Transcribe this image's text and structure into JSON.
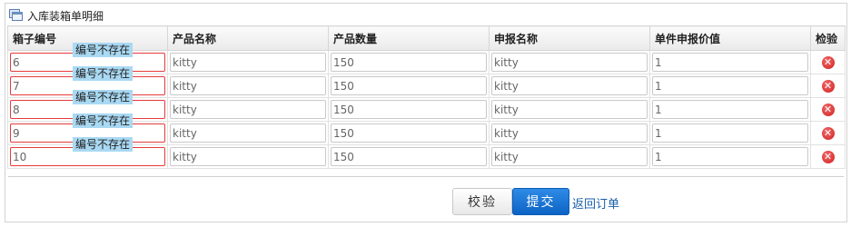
{
  "panel": {
    "title": "入库装箱单明细",
    "icon": "window-icon"
  },
  "table": {
    "headers": [
      "箱子编号",
      "产品名称",
      "产品数量",
      "申报名称",
      "单件申报价值",
      "检验"
    ],
    "error_tip": "编号不存在",
    "rows": [
      {
        "box_no": "6",
        "product_name": "kitty",
        "quantity": "150",
        "declare_name": "kitty",
        "unit_value": "1"
      },
      {
        "box_no": "7",
        "product_name": "kitty",
        "quantity": "150",
        "declare_name": "kitty",
        "unit_value": "1"
      },
      {
        "box_no": "8",
        "product_name": "kitty",
        "quantity": "150",
        "declare_name": "kitty",
        "unit_value": "1"
      },
      {
        "box_no": "9",
        "product_name": "kitty",
        "quantity": "150",
        "declare_name": "kitty",
        "unit_value": "1"
      },
      {
        "box_no": "10",
        "product_name": "kitty",
        "quantity": "150",
        "declare_name": "kitty",
        "unit_value": "1"
      }
    ],
    "delete_symbol": "✕"
  },
  "actions": {
    "check_label": "校验",
    "submit_label": "提交",
    "back_label": "返回订单"
  },
  "colors": {
    "error_border": "#e53b3b",
    "tip_bg": "#a9d9f3",
    "submit_bg": "#1472d3",
    "link": "#1a5fa8"
  }
}
